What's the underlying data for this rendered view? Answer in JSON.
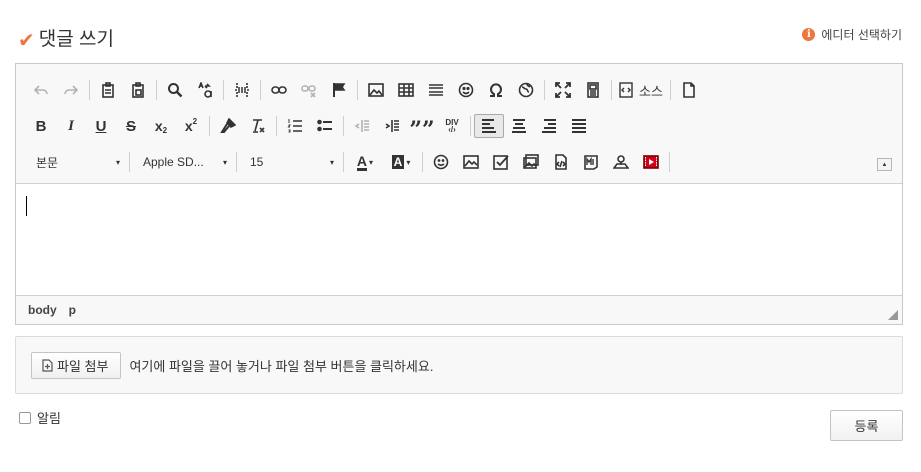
{
  "header": {
    "title": "댓글 쓰기",
    "editor_select": "에디터 선택하기",
    "info_icon_glyph": "i"
  },
  "colors": {
    "accent": "#f0743c",
    "toolbar_bg": "#f8f8f8",
    "border": "#c9c9c9"
  },
  "toolbar": {
    "row1": [
      "undo-icon",
      "redo-icon",
      "paste-icon",
      "paste-word-icon",
      "find-icon",
      "replace-icon",
      "page-break-icon",
      "link-icon",
      "unlink-icon",
      "anchor-icon",
      "image-icon",
      "table-icon",
      "horizontal-rule-icon",
      "emoji-icon",
      "special-char-icon",
      "iframe-icon",
      "maximize-icon",
      "blocks-icon",
      "source-icon",
      "new-page-icon"
    ],
    "source_label": "소스",
    "bold": "B",
    "italic": "I",
    "underline": "U",
    "strike": "S",
    "subscript": "x",
    "superscript": "x",
    "quote": "””",
    "div": "DIV",
    "format_combo": "본문",
    "font_combo": "Apple SD...",
    "size_combo": "15",
    "text_color": "A",
    "bg_color": "A",
    "dropdown_arrow": "▾",
    "collapse_arrow": "▲"
  },
  "statusbar": {
    "path": [
      "body",
      "p"
    ]
  },
  "attach": {
    "button_label": "파일 첨부",
    "hint": "여기에 파일을 끌어 놓거나 파일 첨부 버튼을 클릭하세요."
  },
  "notify_label": "알림",
  "submit_label": "등록"
}
